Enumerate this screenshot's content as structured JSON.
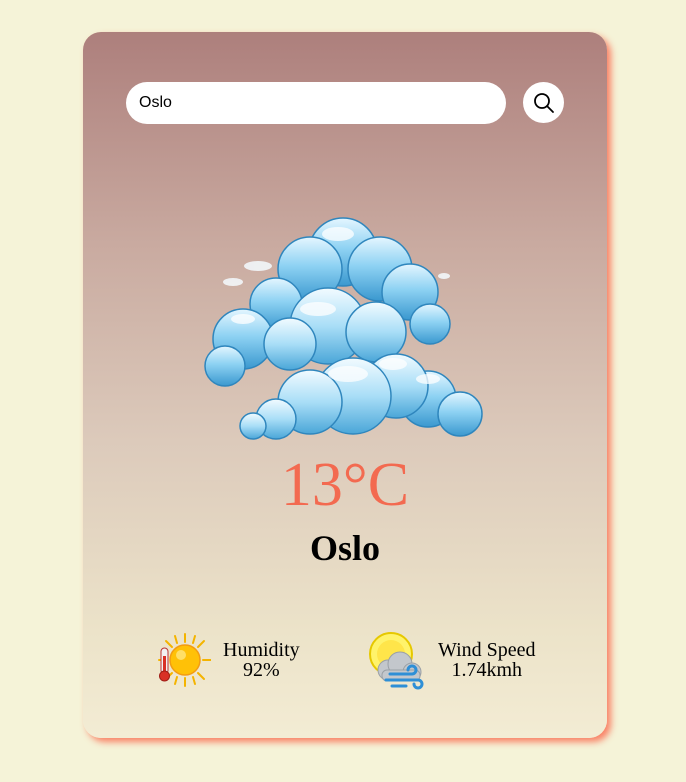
{
  "search": {
    "value": "Oslo"
  },
  "weather": {
    "temperature": "13°C",
    "city": "Oslo"
  },
  "details": {
    "humidity": {
      "label": "Humidity",
      "value": "92%"
    },
    "wind": {
      "label": "Wind Speed",
      "value": "1.74kmh"
    }
  },
  "icons": {
    "search": "search-icon",
    "weather": "cloud-icon",
    "humidity": "sun-thermometer-icon",
    "wind": "wind-icon"
  },
  "colors": {
    "temperature": "#f36a50",
    "page_background": "#f5f3d8",
    "card_shadow": "#fa765a"
  }
}
